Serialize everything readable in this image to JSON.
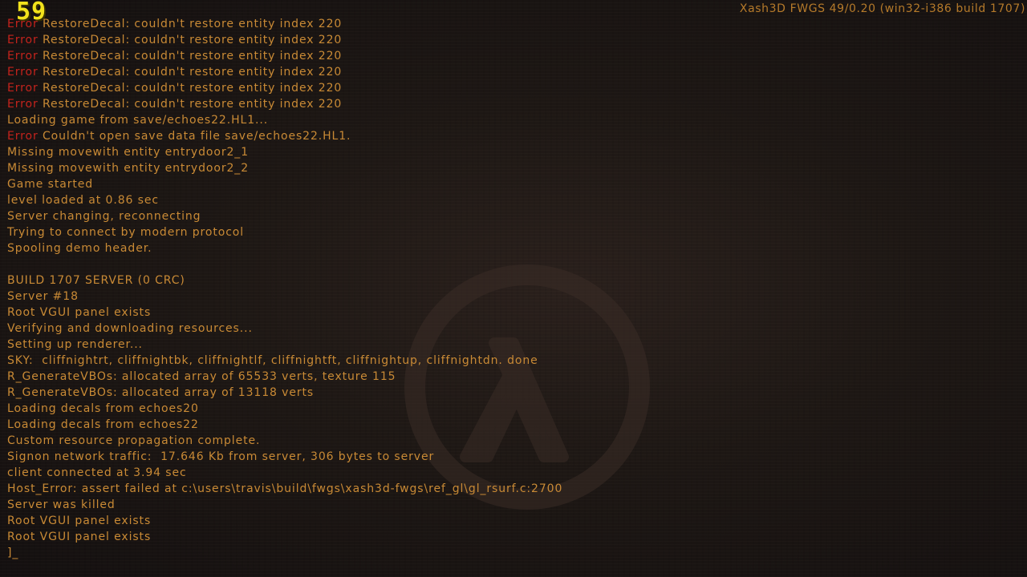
{
  "fps": "59",
  "version": "Xash3D FWGS 49/0.20 (win32-i386 build 1707)",
  "colors": {
    "text": "#c98a35",
    "error": "#c4231c",
    "fps": "#f2e21c",
    "background": "#1a1412"
  },
  "console": {
    "lines": [
      {
        "prefix": "Error",
        "text": "RestoreDecal: couldn't restore entity index 220"
      },
      {
        "prefix": "Error",
        "text": "RestoreDecal: couldn't restore entity index 220"
      },
      {
        "prefix": "Error",
        "text": "RestoreDecal: couldn't restore entity index 220"
      },
      {
        "prefix": "Error",
        "text": "RestoreDecal: couldn't restore entity index 220"
      },
      {
        "prefix": "Error",
        "text": "RestoreDecal: couldn't restore entity index 220"
      },
      {
        "prefix": "Error",
        "text": "RestoreDecal: couldn't restore entity index 220"
      },
      {
        "prefix": "",
        "text": "Loading game from save/echoes22.HL1..."
      },
      {
        "prefix": "Error",
        "text": "Couldn't open save data file save/echoes22.HL1."
      },
      {
        "prefix": "",
        "text": "Missing movewith entity entrydoor2_1"
      },
      {
        "prefix": "",
        "text": "Missing movewith entity entrydoor2_2"
      },
      {
        "prefix": "",
        "text": "Game started"
      },
      {
        "prefix": "",
        "text": "level loaded at 0.86 sec"
      },
      {
        "prefix": "",
        "text": "Server changing, reconnecting"
      },
      {
        "prefix": "",
        "text": "Trying to connect by modern protocol"
      },
      {
        "prefix": "",
        "text": "Spooling demo header."
      },
      {
        "prefix": "",
        "text": ""
      },
      {
        "prefix": "",
        "text": "BUILD 1707 SERVER (0 CRC)"
      },
      {
        "prefix": "",
        "text": "Server #18"
      },
      {
        "prefix": "",
        "text": "Root VGUI panel exists"
      },
      {
        "prefix": "",
        "text": "Verifying and downloading resources..."
      },
      {
        "prefix": "",
        "text": "Setting up renderer..."
      },
      {
        "prefix": "",
        "text": "SKY:  cliffnightrt, cliffnightbk, cliffnightlf, cliffnightft, cliffnightup, cliffnightdn. done"
      },
      {
        "prefix": "",
        "text": "R_GenerateVBOs: allocated array of 65533 verts, texture 115"
      },
      {
        "prefix": "",
        "text": "R_GenerateVBOs: allocated array of 13118 verts"
      },
      {
        "prefix": "",
        "text": "Loading decals from echoes20"
      },
      {
        "prefix": "",
        "text": "Loading decals from echoes22"
      },
      {
        "prefix": "",
        "text": "Custom resource propagation complete."
      },
      {
        "prefix": "",
        "text": "Signon network traffic:  17.646 Kb from server, 306 bytes to server"
      },
      {
        "prefix": "",
        "text": "client connected at 3.94 sec"
      },
      {
        "prefix": "",
        "text": "Host_Error: assert failed at c:\\users\\travis\\build\\fwgs\\xash3d-fwgs\\ref_gl\\gl_rsurf.c:2700"
      },
      {
        "prefix": "",
        "text": "Server was killed"
      },
      {
        "prefix": "",
        "text": "Root VGUI panel exists"
      },
      {
        "prefix": "",
        "text": "Root VGUI panel exists"
      }
    ],
    "prompt": "]_"
  },
  "background_logo": "half-life-lambda-icon"
}
